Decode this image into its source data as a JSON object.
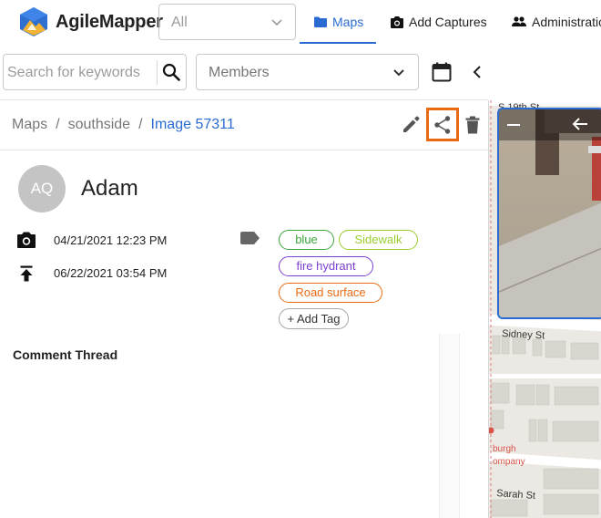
{
  "app": {
    "name": "AgileMapper"
  },
  "header": {
    "filter_select": {
      "value": "All"
    },
    "nav": [
      {
        "label": "Maps",
        "icon": "folder-icon",
        "active": true
      },
      {
        "label": "Add Captures",
        "icon": "camera-icon",
        "active": false
      },
      {
        "label": "Administration",
        "icon": "people-icon",
        "active": false
      }
    ]
  },
  "toolbar": {
    "search": {
      "placeholder": "Search for keywords",
      "value": ""
    },
    "members_select": {
      "value": "Members"
    }
  },
  "breadcrumb": {
    "items": [
      "Maps",
      "southside"
    ],
    "current": "Image 57311",
    "separator": "/"
  },
  "capture": {
    "user": {
      "initials": "AQ",
      "name": "Adam"
    },
    "captured_at": "04/21/2021 12:23 PM",
    "uploaded_at": "06/22/2021 03:54 PM",
    "tags": [
      {
        "label": "blue",
        "color": "#3aa53a"
      },
      {
        "label": "Sidewalk",
        "color": "#9acd32"
      },
      {
        "label": "fire hydrant",
        "color": "#7b3fd1"
      },
      {
        "label": "Road surface",
        "color": "#ea6a13"
      }
    ],
    "add_tag_label": "+ Add Tag"
  },
  "comments": {
    "title": "Comment Thread"
  },
  "map": {
    "street_labels": [
      "S 19th St",
      "Sidney St",
      "Sarah St"
    ],
    "poi_label_lines": [
      "burgh",
      "ompany"
    ]
  },
  "colors": {
    "accent": "#2a6bd1",
    "highlight": "#ea6a13"
  }
}
